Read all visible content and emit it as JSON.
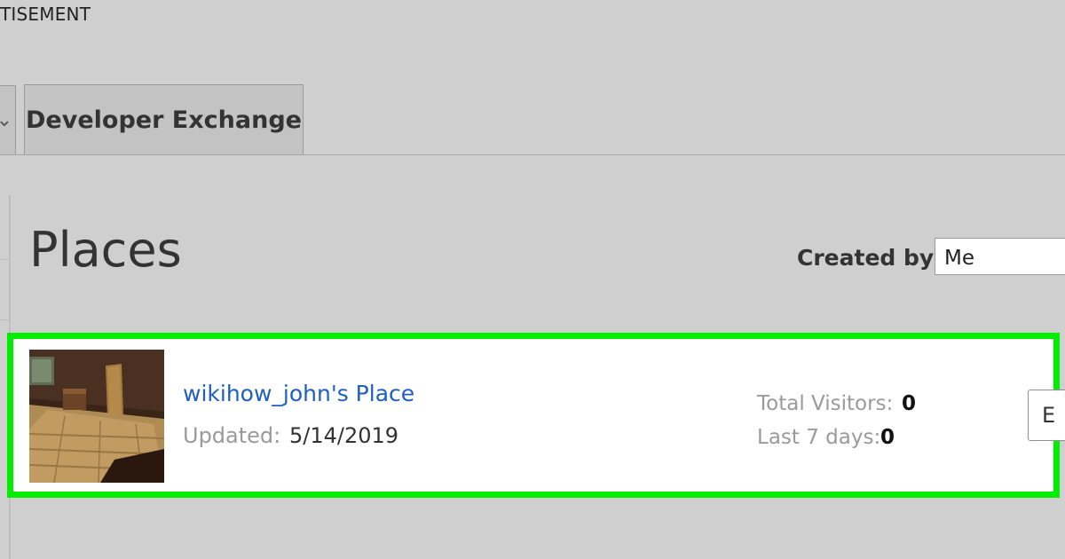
{
  "header": {
    "top_label": "TISEMENT"
  },
  "tabs": [
    {
      "label": ""
    },
    {
      "label": "Developer Exchange"
    }
  ],
  "page": {
    "title": "Places",
    "filter": {
      "label": "Created by:",
      "value": "Me"
    }
  },
  "place": {
    "name": "wikihow_john's Place",
    "updated_label": "Updated:",
    "updated_value": "5/14/2019",
    "total_visitors_label": "Total Visitors:",
    "total_visitors_value": "0",
    "last7_label": "Last 7 days:",
    "last7_value": "0",
    "edit_label": "E",
    "highlight_color": "#00ee00",
    "link_color": "#1f5fbf"
  }
}
